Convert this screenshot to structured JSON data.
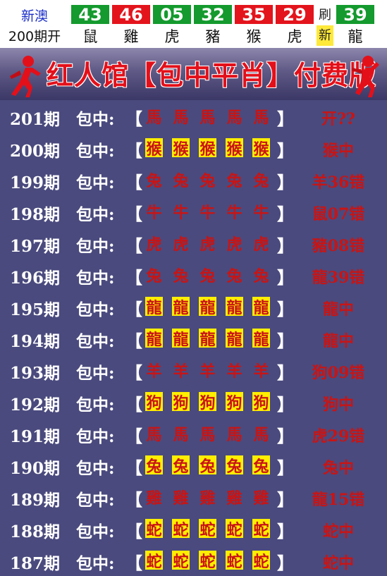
{
  "header": {
    "lottery": "新澳",
    "draw_label": "200期开",
    "balls": [
      {
        "num": "43",
        "zodiac": "鼠",
        "color": "#149a2e"
      },
      {
        "num": "46",
        "zodiac": "雞",
        "color": "#e3141c"
      },
      {
        "num": "05",
        "zodiac": "虎",
        "color": "#149a2e"
      },
      {
        "num": "32",
        "zodiac": "豬",
        "color": "#149a2e"
      },
      {
        "num": "35",
        "zodiac": "猴",
        "color": "#e3141c"
      },
      {
        "num": "29",
        "zodiac": "虎",
        "color": "#e3141c"
      }
    ],
    "refresh": {
      "top": "刷",
      "bottom": "新"
    },
    "special": {
      "num": "39",
      "zodiac": "龍",
      "color": "#149a2e"
    }
  },
  "banner": {
    "title": "红人馆【包中平肖】付费版"
  },
  "rows": [
    {
      "issue": "201期",
      "label": "包中:",
      "zodiac": "馬",
      "hit": false,
      "result": "开??"
    },
    {
      "issue": "200期",
      "label": "包中:",
      "zodiac": "猴",
      "hit": true,
      "result": "猴中"
    },
    {
      "issue": "199期",
      "label": "包中:",
      "zodiac": "兔",
      "hit": false,
      "result": "羊36错"
    },
    {
      "issue": "198期",
      "label": "包中:",
      "zodiac": "牛",
      "hit": false,
      "result": "鼠07错"
    },
    {
      "issue": "197期",
      "label": "包中:",
      "zodiac": "虎",
      "hit": false,
      "result": "豬08错"
    },
    {
      "issue": "196期",
      "label": "包中:",
      "zodiac": "兔",
      "hit": false,
      "result": "龍39错"
    },
    {
      "issue": "195期",
      "label": "包中:",
      "zodiac": "龍",
      "hit": true,
      "result": "龍中"
    },
    {
      "issue": "194期",
      "label": "包中:",
      "zodiac": "龍",
      "hit": true,
      "result": "龍中"
    },
    {
      "issue": "193期",
      "label": "包中:",
      "zodiac": "羊",
      "hit": false,
      "result": "狗09错"
    },
    {
      "issue": "192期",
      "label": "包中:",
      "zodiac": "狗",
      "hit": true,
      "result": "狗中"
    },
    {
      "issue": "191期",
      "label": "包中:",
      "zodiac": "馬",
      "hit": false,
      "result": "虎29错"
    },
    {
      "issue": "190期",
      "label": "包中:",
      "zodiac": "兔",
      "hit": true,
      "result": "兔中"
    },
    {
      "issue": "189期",
      "label": "包中:",
      "zodiac": "雞",
      "hit": false,
      "result": "龍15错"
    },
    {
      "issue": "188期",
      "label": "包中:",
      "zodiac": "蛇",
      "hit": true,
      "result": "蛇中"
    },
    {
      "issue": "187期",
      "label": "包中:",
      "zodiac": "蛇",
      "hit": true,
      "result": "蛇中"
    }
  ]
}
